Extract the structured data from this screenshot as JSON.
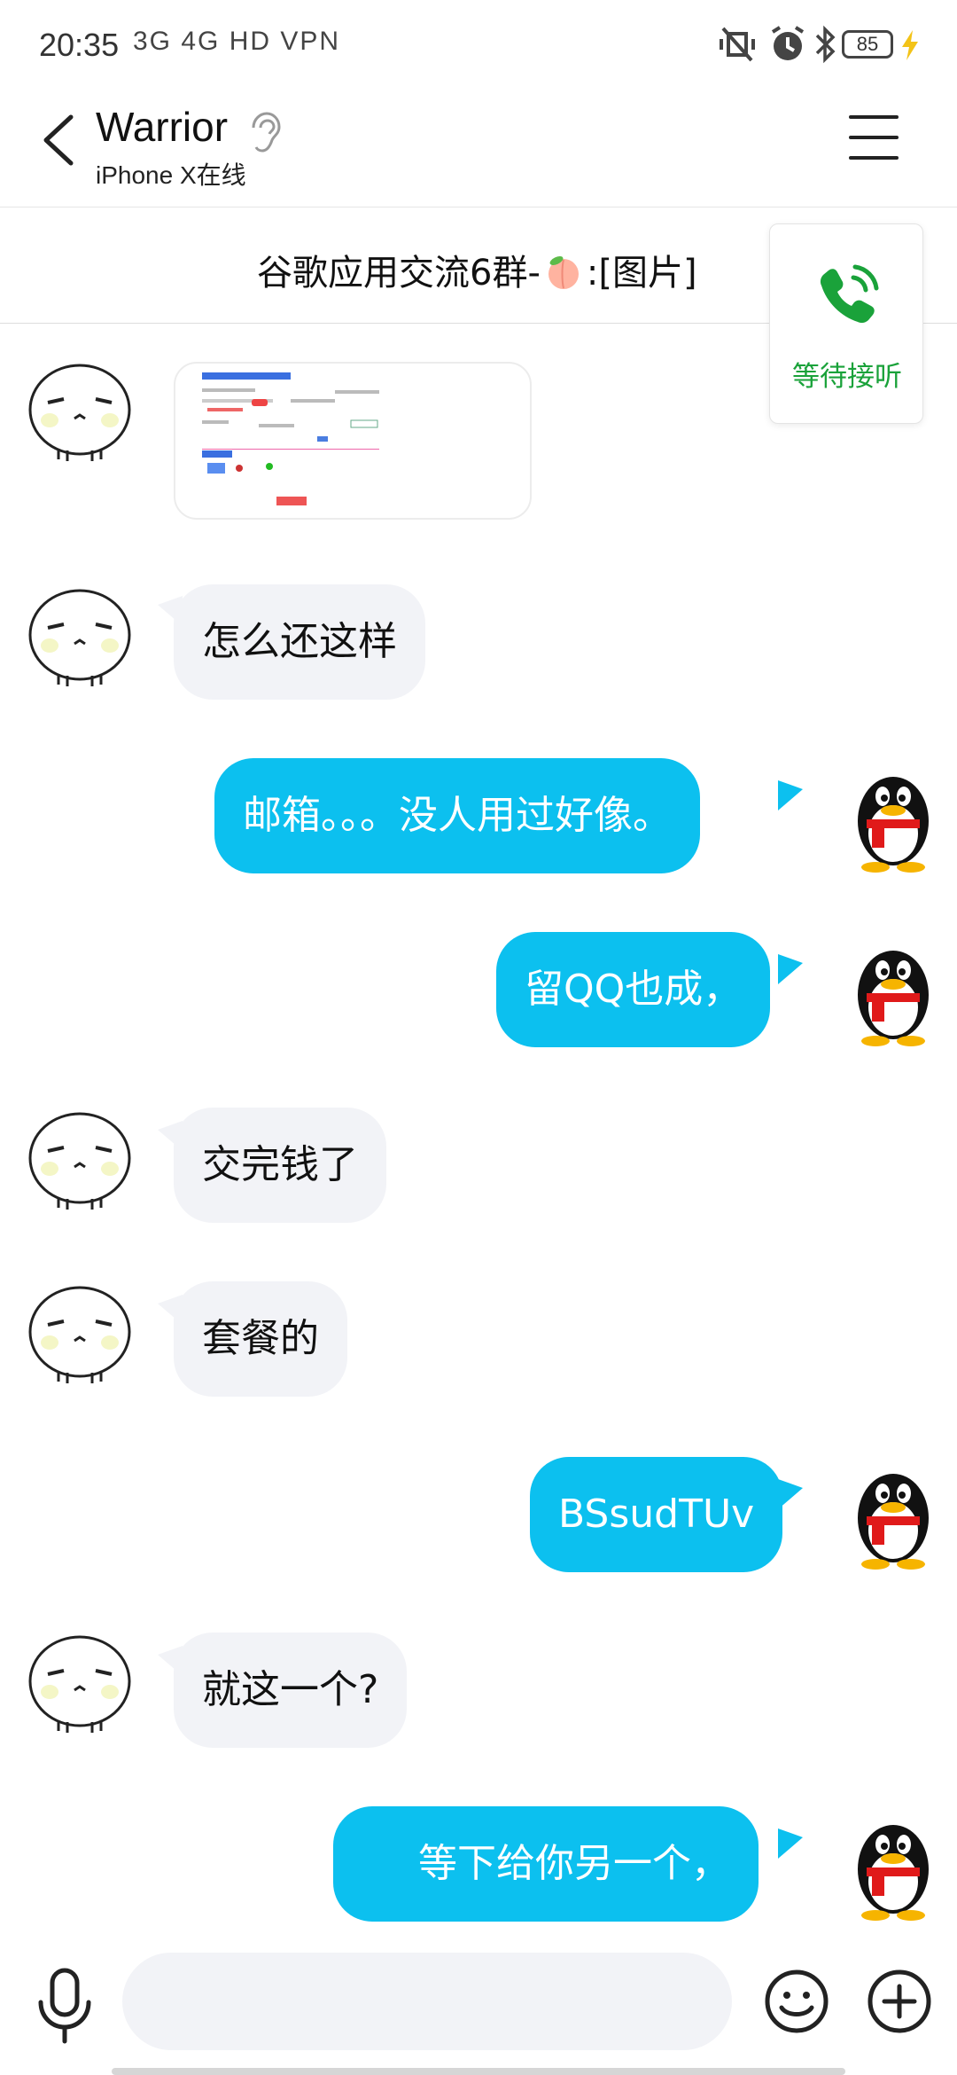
{
  "status_bar": {
    "time": "20:35",
    "network": "3G 4G HD VPN",
    "battery": "85",
    "accent_charging": "#f3c318"
  },
  "header": {
    "contact_name": "Warrior",
    "device_status": "iPhone X在线"
  },
  "banner": {
    "text_prefix": "谷歌应用交流6群-",
    "text_suffix": ":[图片]"
  },
  "call_card": {
    "label": "等待接听",
    "color": "#1aa23a"
  },
  "messages": [
    {
      "side": "in",
      "type": "image"
    },
    {
      "side": "in",
      "text": "怎么还这样"
    },
    {
      "side": "out",
      "text": "邮箱。。。没人用过好像。"
    },
    {
      "side": "out",
      "text": "留QQ也成，"
    },
    {
      "side": "in",
      "text": "交完钱了"
    },
    {
      "side": "in",
      "text": "套餐的"
    },
    {
      "side": "out",
      "text": "BSsudTUv"
    },
    {
      "side": "in",
      "text": "就这一个?"
    },
    {
      "side": "out",
      "text": "等下给你另一个，"
    }
  ],
  "colors": {
    "outgoing_bubble": "#0cc0ef",
    "incoming_bubble": "#f2f3f7"
  },
  "icons": {
    "back": "chevron-left-icon",
    "ear": "ear-icon",
    "menu": "hamburger-icon",
    "phone": "phone-ringing-icon",
    "mic": "microphone-icon",
    "emoji": "smiley-icon",
    "plus": "plus-circle-icon"
  }
}
